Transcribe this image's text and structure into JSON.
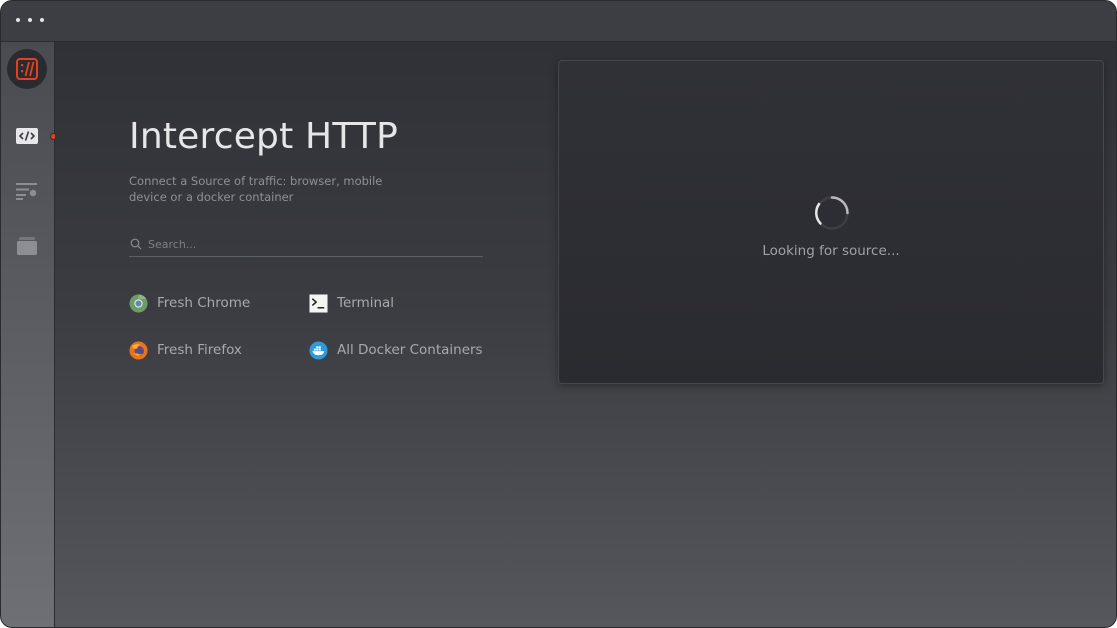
{
  "window": {
    "titlebar_dots": 3
  },
  "sidebar": {
    "items": [
      {
        "name": "intercept",
        "icon": "code-icon",
        "active": true
      },
      {
        "name": "view",
        "icon": "list-filter-icon",
        "active": false
      },
      {
        "name": "mock",
        "icon": "stack-icon",
        "active": false
      }
    ]
  },
  "main": {
    "title": "Intercept HTTP",
    "subtitle": "Connect a Source of traffic: browser, mobile device or a docker container",
    "search": {
      "placeholder": "Search...",
      "value": ""
    },
    "options": [
      {
        "label": "Fresh Chrome",
        "icon": "chrome-icon"
      },
      {
        "label": "Terminal",
        "icon": "terminal-icon"
      },
      {
        "label": "Fresh Firefox",
        "icon": "firefox-icon"
      },
      {
        "label": "All Docker Containers",
        "icon": "docker-icon"
      }
    ]
  },
  "panel": {
    "status": "Looking for source..."
  },
  "colors": {
    "accent": "#e1421f",
    "background": "#303137",
    "text": "#e6e6e8"
  }
}
